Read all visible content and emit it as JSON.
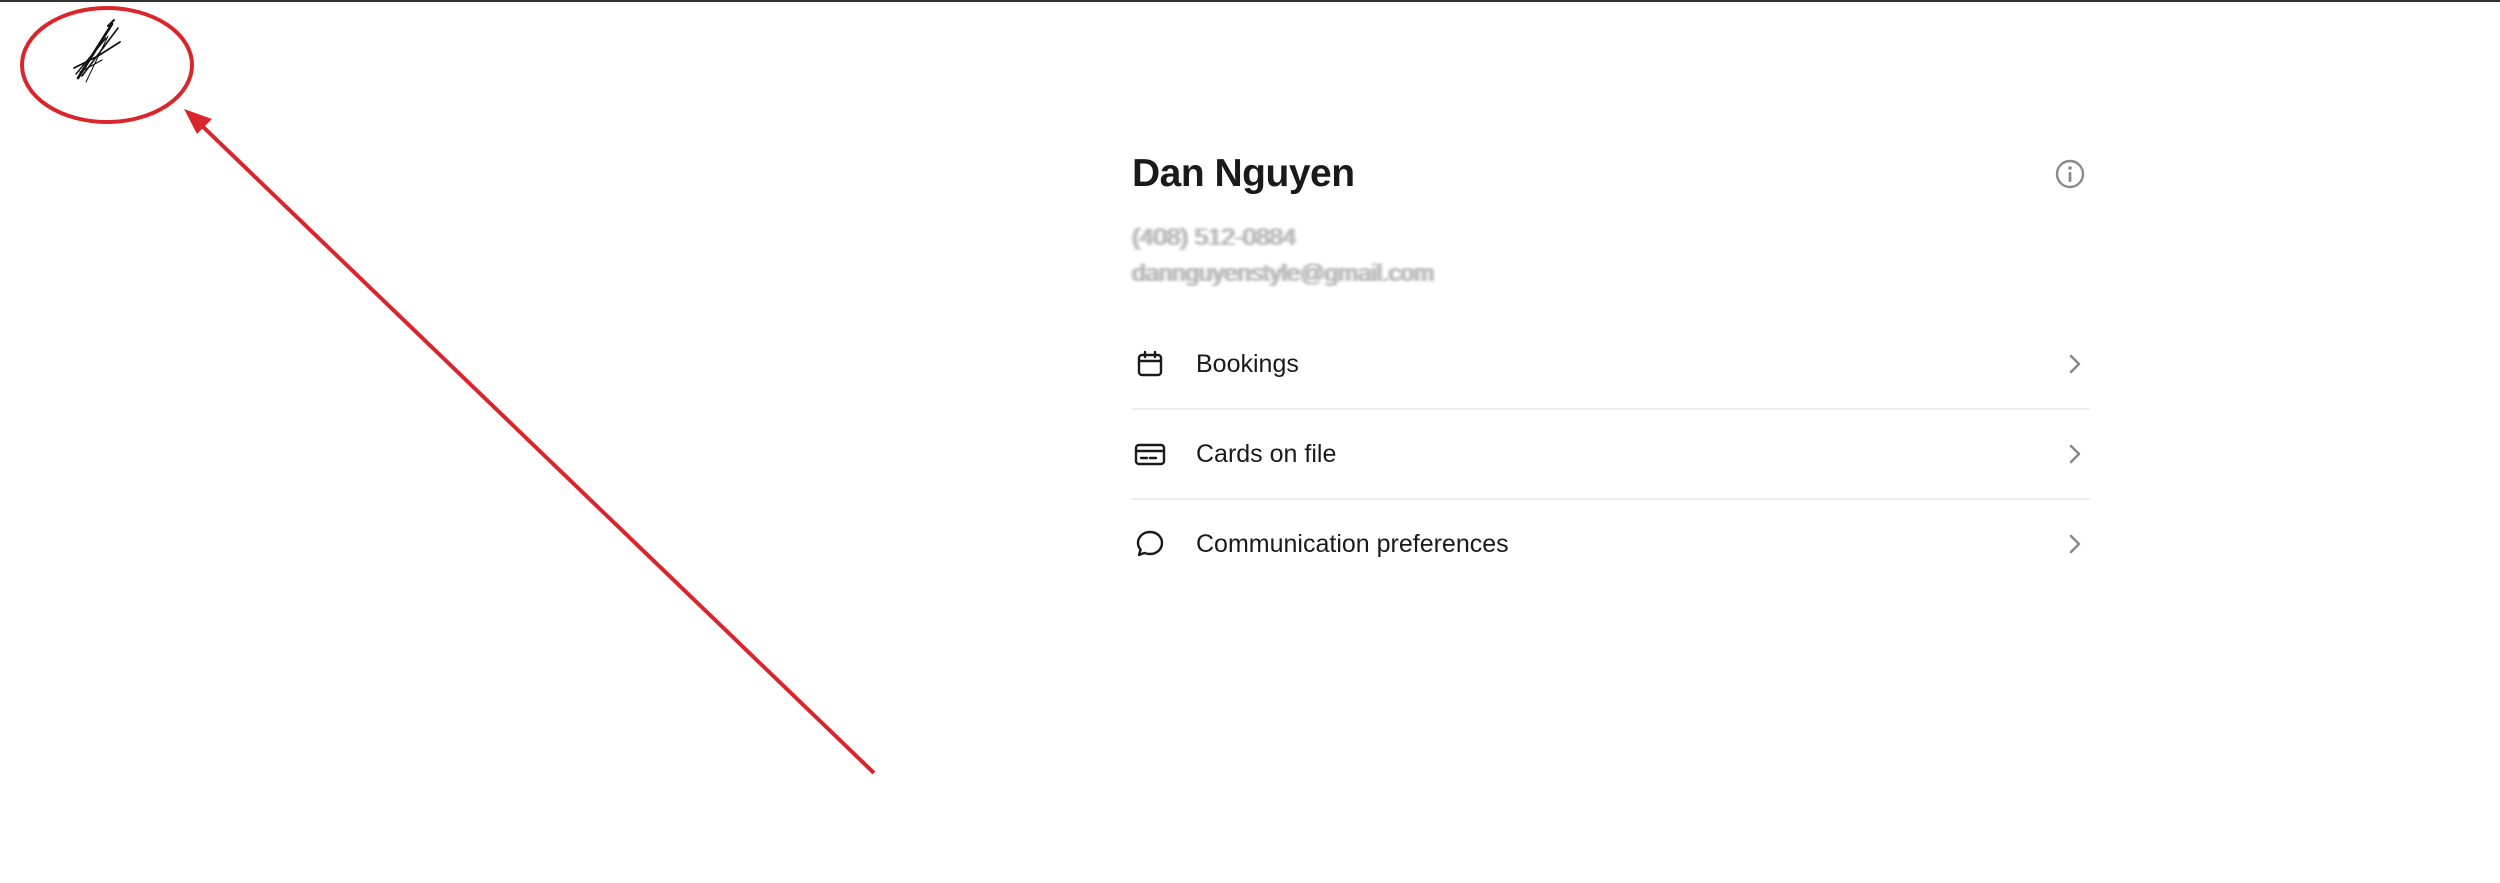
{
  "profile": {
    "name": "Dan Nguyen",
    "phone": "(408) 512-0884",
    "email": "dannguyenstyle@gmail.com",
    "info_icon": "info-circle-icon"
  },
  "menu": {
    "items": [
      {
        "label": "Bookings",
        "icon": "calendar-icon"
      },
      {
        "label": "Cards on file",
        "icon": "credit-card-icon"
      },
      {
        "label": "Communication preferences",
        "icon": "chat-bubble-icon"
      }
    ]
  },
  "colors": {
    "annotation": "#d9262c",
    "text": "#1a1a1a",
    "muted_icon": "#8a8a8a",
    "divider": "#ececec"
  }
}
